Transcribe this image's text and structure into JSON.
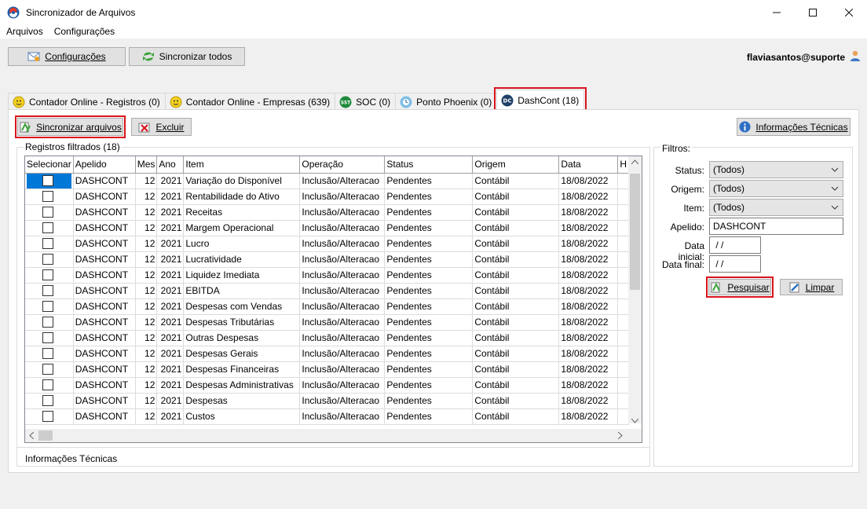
{
  "window": {
    "title": "Sincronizador de Arquivos",
    "minimize": "—",
    "maximize": "☐",
    "close": "✕"
  },
  "menu": [
    "Arquivos",
    "Configurações"
  ],
  "toolbar": {
    "configuracoes": "Configurações",
    "sincronizar_todos": "Sincronizar todos",
    "user": "flaviasantos@suporte"
  },
  "tabs": [
    {
      "label": "Contador Online - Registros (0)",
      "icon": "smiley-icon"
    },
    {
      "label": "Contador Online - Empresas (639)",
      "icon": "smiley-icon"
    },
    {
      "label": "SOC (0)",
      "icon": "sst-icon"
    },
    {
      "label": "Ponto Phoenix (0)",
      "icon": "phoenix-icon"
    },
    {
      "label": "DashCont (18)",
      "icon": "dc-icon"
    }
  ],
  "actions": {
    "sincronizar_arquivos": "Sincronizar arquivos",
    "excluir": "Excluir",
    "info_tecnicas": "Informações Técnicas"
  },
  "grid": {
    "group_title": "Registros filtrados (18)",
    "columns": [
      "Selecionar",
      "Apelido",
      "Mes",
      "Ano",
      "Item",
      "Operação",
      "Status",
      "Origem",
      "Data",
      "H"
    ],
    "rows": [
      [
        "DASHCONT",
        "12",
        "2021",
        "Variação do Disponível",
        "Inclusão/Alteracao",
        "Pendentes",
        "Contábil",
        "18/08/2022"
      ],
      [
        "DASHCONT",
        "12",
        "2021",
        "Rentabilidade do Ativo",
        "Inclusão/Alteracao",
        "Pendentes",
        "Contábil",
        "18/08/2022"
      ],
      [
        "DASHCONT",
        "12",
        "2021",
        "Receitas",
        "Inclusão/Alteracao",
        "Pendentes",
        "Contábil",
        "18/08/2022"
      ],
      [
        "DASHCONT",
        "12",
        "2021",
        "Margem Operacional",
        "Inclusão/Alteracao",
        "Pendentes",
        "Contábil",
        "18/08/2022"
      ],
      [
        "DASHCONT",
        "12",
        "2021",
        "Lucro",
        "Inclusão/Alteracao",
        "Pendentes",
        "Contábil",
        "18/08/2022"
      ],
      [
        "DASHCONT",
        "12",
        "2021",
        "Lucratividade",
        "Inclusão/Alteracao",
        "Pendentes",
        "Contábil",
        "18/08/2022"
      ],
      [
        "DASHCONT",
        "12",
        "2021",
        "Liquidez Imediata",
        "Inclusão/Alteracao",
        "Pendentes",
        "Contábil",
        "18/08/2022"
      ],
      [
        "DASHCONT",
        "12",
        "2021",
        "EBITDA",
        "Inclusão/Alteracao",
        "Pendentes",
        "Contábil",
        "18/08/2022"
      ],
      [
        "DASHCONT",
        "12",
        "2021",
        "Despesas com Vendas",
        "Inclusão/Alteracao",
        "Pendentes",
        "Contábil",
        "18/08/2022"
      ],
      [
        "DASHCONT",
        "12",
        "2021",
        "Despesas Tributárias",
        "Inclusão/Alteracao",
        "Pendentes",
        "Contábil",
        "18/08/2022"
      ],
      [
        "DASHCONT",
        "12",
        "2021",
        "Outras Despesas",
        "Inclusão/Alteracao",
        "Pendentes",
        "Contábil",
        "18/08/2022"
      ],
      [
        "DASHCONT",
        "12",
        "2021",
        "Despesas Gerais",
        "Inclusão/Alteracao",
        "Pendentes",
        "Contábil",
        "18/08/2022"
      ],
      [
        "DASHCONT",
        "12",
        "2021",
        "Despesas Financeiras",
        "Inclusão/Alteracao",
        "Pendentes",
        "Contábil",
        "18/08/2022"
      ],
      [
        "DASHCONT",
        "12",
        "2021",
        "Despesas Administrativas",
        "Inclusão/Alteracao",
        "Pendentes",
        "Contábil",
        "18/08/2022"
      ],
      [
        "DASHCONT",
        "12",
        "2021",
        "Despesas",
        "Inclusão/Alteracao",
        "Pendentes",
        "Contábil",
        "18/08/2022"
      ],
      [
        "DASHCONT",
        "12",
        "2021",
        "Custos",
        "Inclusão/Alteracao",
        "Pendentes",
        "Contábil",
        "18/08/2022"
      ]
    ],
    "bottom_label": "Informações Técnicas"
  },
  "filters": {
    "title": "Filtros:",
    "status_label": "Status:",
    "status_value": "(Todos)",
    "origem_label": "Origem:",
    "origem_value": "(Todos)",
    "item_label": "Item:",
    "item_value": "(Todos)",
    "apelido_label": "Apelido:",
    "apelido_value": "DASHCONT",
    "data_inicial_label": "Data inicial:",
    "data_inicial_value": " / /",
    "data_final_label": "Data final:",
    "data_final_value": " / /",
    "pesquisar": "Pesquisar",
    "limpar": "Limpar"
  },
  "colors": {
    "highlight": "#d9141d",
    "selection": "#0078d7"
  }
}
